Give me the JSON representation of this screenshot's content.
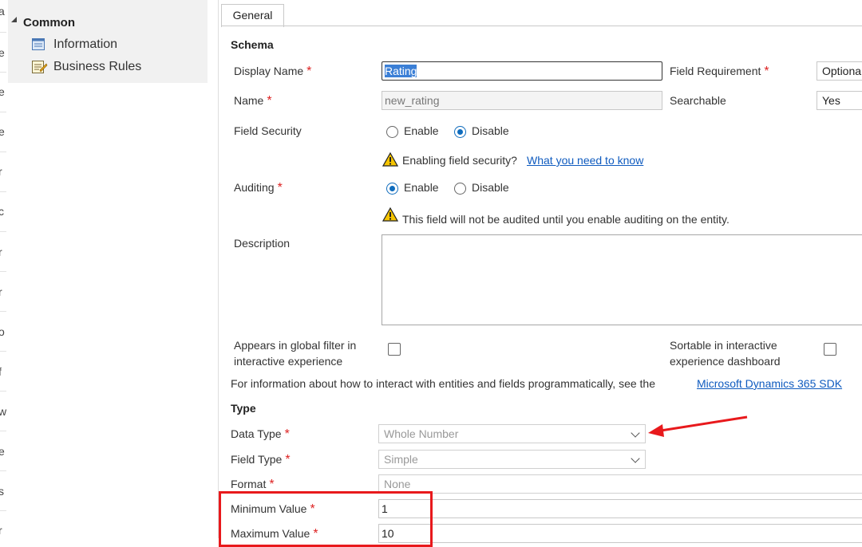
{
  "left_edge": {
    "letters": [
      "a",
      "e",
      "e",
      "e",
      "r",
      "c",
      "r",
      "r",
      "o",
      "f",
      "w",
      "e",
      "s",
      "r"
    ]
  },
  "sidebar": {
    "group_label": "Common",
    "items": [
      {
        "label": "Information",
        "icon": "form-icon"
      },
      {
        "label": "Business Rules",
        "icon": "business-rules-icon"
      }
    ]
  },
  "tabs": [
    {
      "label": "General"
    }
  ],
  "schema": {
    "heading": "Schema",
    "display_name": {
      "label": "Display Name",
      "value": "Rating"
    },
    "field_requirement": {
      "label": "Field Requirement",
      "value": "Optiona"
    },
    "name": {
      "label": "Name",
      "value": "new_rating"
    },
    "searchable": {
      "label": "Searchable",
      "value": "Yes"
    },
    "field_security": {
      "label": "Field Security",
      "options": [
        "Enable",
        "Disable"
      ],
      "selected": "Disable",
      "warning_text": "Enabling field security?",
      "warning_link": "What you need to know"
    },
    "auditing": {
      "label": "Auditing",
      "options": [
        "Enable",
        "Disable"
      ],
      "selected": "Enable",
      "warning_text": "This field will not be audited until you enable auditing on the entity."
    },
    "description": {
      "label": "Description",
      "value": ""
    },
    "global_filter": {
      "label_line1": "Appears in global filter in",
      "label_line2": "interactive experience",
      "checked": false
    },
    "sortable": {
      "label_line1": "Sortable in interactive",
      "label_line2": "experience dashboard",
      "checked": false
    },
    "sdk_note": "For information about how to interact with entities and fields programmatically, see the",
    "sdk_link": "Microsoft Dynamics 365 SDK"
  },
  "type": {
    "heading": "Type",
    "data_type": {
      "label": "Data Type",
      "value": "Whole Number"
    },
    "field_type": {
      "label": "Field Type",
      "value": "Simple"
    },
    "format": {
      "label": "Format",
      "value": "None"
    },
    "minimum_value": {
      "label": "Minimum Value",
      "value": "1"
    },
    "maximum_value": {
      "label": "Maximum Value",
      "value": "10"
    }
  },
  "annotation_colors": {
    "arrow": "#e8191c",
    "box": "#e8191c"
  }
}
